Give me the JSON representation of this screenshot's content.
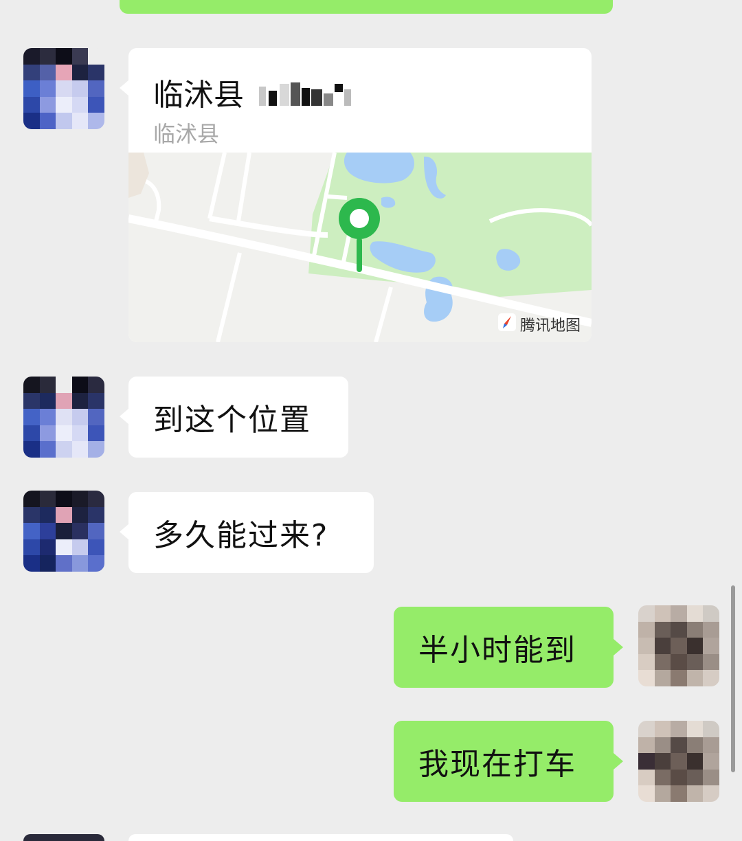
{
  "location_card": {
    "title": "临沭县",
    "subtitle": "临沭县",
    "map_brand": "腾讯地图"
  },
  "messages": [
    {
      "side": "left",
      "text": "到这个位置"
    },
    {
      "side": "left",
      "text": "多久能过来?"
    },
    {
      "side": "right",
      "text": "半小时能到"
    },
    {
      "side": "right",
      "text": "我现在打车"
    }
  ],
  "colors": {
    "chat_background": "#ededed",
    "outgoing_bubble": "#95ec69",
    "incoming_bubble": "#ffffff",
    "map_park": "#cdeec0",
    "map_water": "#a6cdf6",
    "pin": "#2db84d"
  },
  "icons": {
    "map_pin": "location-pin-icon",
    "map_brand": "tencent-map-logo-icon"
  }
}
